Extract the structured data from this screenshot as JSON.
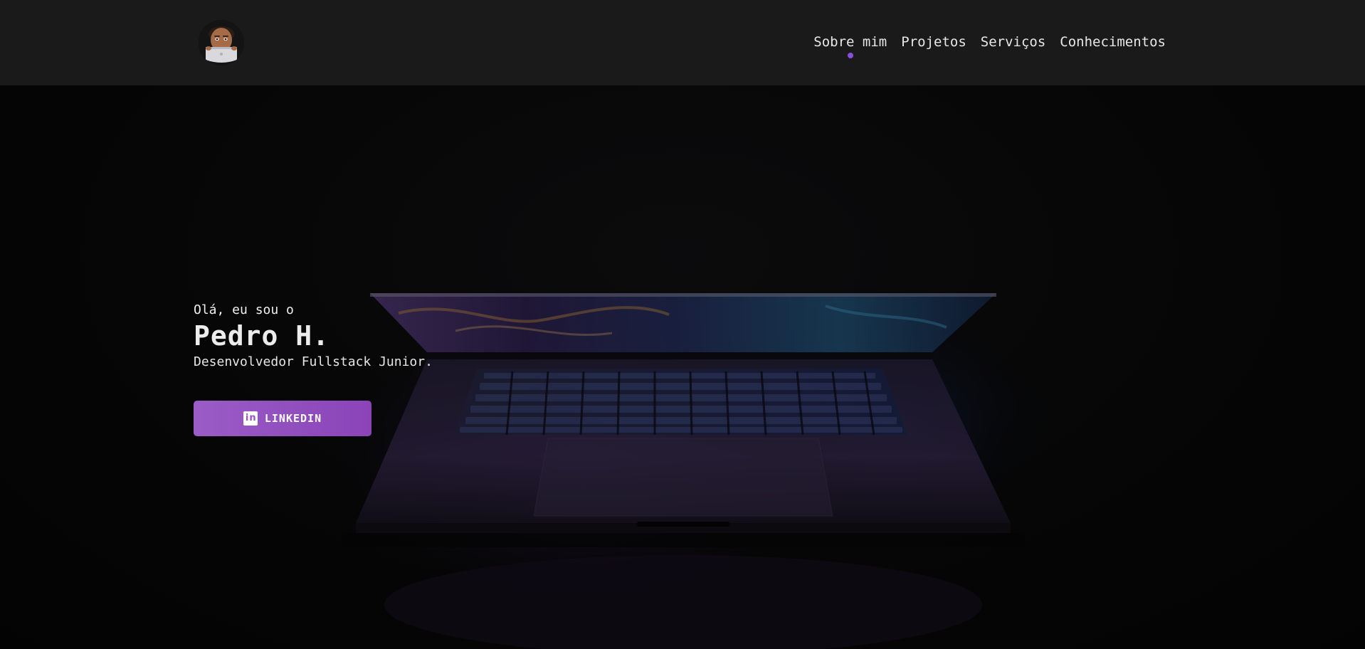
{
  "nav": {
    "items": [
      "Sobre mim",
      "Projetos",
      "Serviços",
      "Conhecimentos"
    ],
    "active_index": 0
  },
  "hero": {
    "greeting": "Olá, eu sou o",
    "name": "Pedro H.",
    "role": "Desenvolvedor Fullstack Junior.",
    "linkedin_label": "LINKEDIN"
  },
  "colors": {
    "accent": "#9b52c2",
    "accent_dark": "#8a46b8",
    "header_bg": "#1a1a1a",
    "nav_dot": "#8a4fd8"
  },
  "icons": {
    "avatar": "memoji-avatar",
    "linkedin": "linkedin-icon",
    "background": "laptop-photo"
  }
}
